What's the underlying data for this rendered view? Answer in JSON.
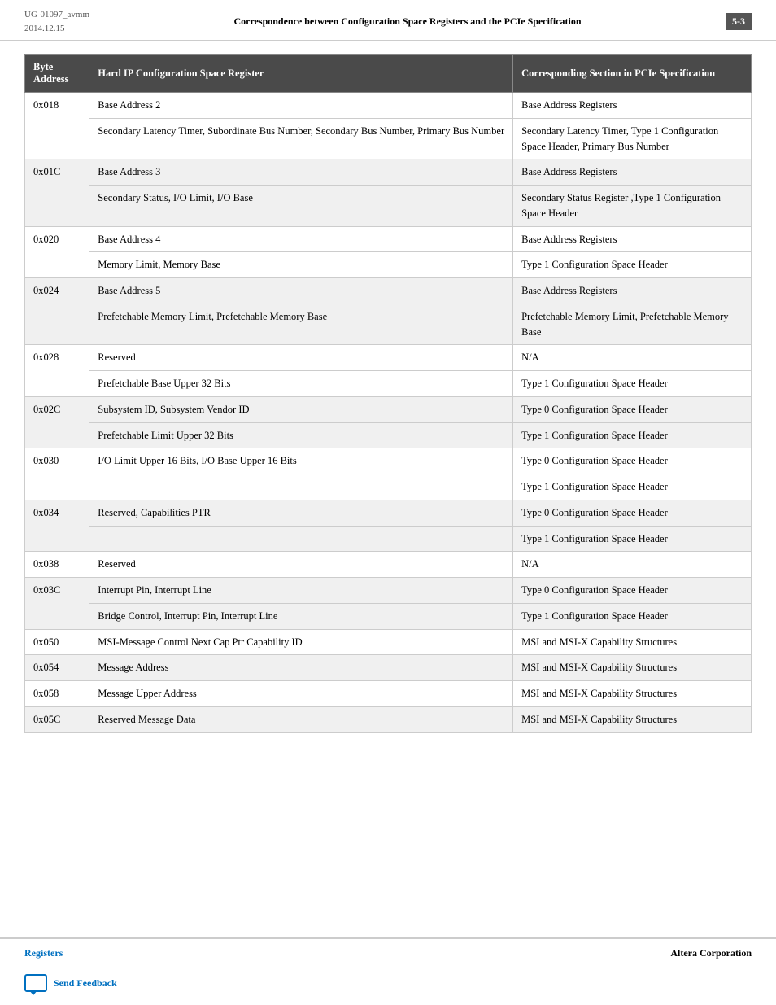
{
  "header": {
    "doc_id": "UG-01097_avmm",
    "date": "2014.12.15",
    "title": "Correspondence between Configuration Space Registers and the PCIe Specification",
    "page": "5-3"
  },
  "table": {
    "columns": [
      "Byte Address",
      "Hard IP Configuration Space Register",
      "Corresponding Section in PCIe Specification"
    ],
    "rows": [
      {
        "address": "0x018",
        "register": "Base Address 2",
        "spec": "Base Address Registers",
        "shaded": false,
        "rowspan": 2
      },
      {
        "address": "",
        "register": "Secondary Latency Timer, Subordinate Bus Number, Secondary Bus Number, Primary Bus Number",
        "spec": "Secondary Latency Timer, Type 1 Configuration Space Header, Primary Bus Number",
        "shaded": false
      },
      {
        "address": "0x01C",
        "register": "Base Address 3",
        "spec": "Base Address Registers",
        "shaded": true,
        "rowspan": 2
      },
      {
        "address": "",
        "register": "Secondary Status, I/O Limit, I/O Base",
        "spec": "Secondary Status Register ,Type 1 Configuration Space Header",
        "shaded": true
      },
      {
        "address": "0x020",
        "register": "Base Address 4",
        "spec": "Base Address Registers",
        "shaded": false,
        "rowspan": 2
      },
      {
        "address": "",
        "register": "Memory Limit, Memory Base",
        "spec": "Type 1 Configuration Space Header",
        "shaded": false
      },
      {
        "address": "0x024",
        "register": "Base Address 5",
        "spec": "Base Address Registers",
        "shaded": true,
        "rowspan": 2
      },
      {
        "address": "",
        "register": "Prefetchable Memory Limit, Prefetchable Memory Base",
        "spec": "Prefetchable Memory Limit, Prefetchable Memory Base",
        "shaded": true
      },
      {
        "address": "0x028",
        "register": "Reserved",
        "spec": "N/A",
        "shaded": false,
        "rowspan": 2
      },
      {
        "address": "",
        "register": "Prefetchable Base Upper 32 Bits",
        "spec": "Type 1 Configuration Space Header",
        "shaded": false
      },
      {
        "address": "0x02C",
        "register": "Subsystem ID, Subsystem Vendor ID",
        "spec": "Type 0 Configuration Space Header",
        "shaded": true,
        "rowspan": 2
      },
      {
        "address": "",
        "register": "Prefetchable Limit Upper 32 Bits",
        "spec": "Type 1 Configuration Space Header",
        "shaded": true
      },
      {
        "address": "0x030",
        "register": "I/O Limit Upper 16 Bits, I/O Base Upper 16 Bits",
        "spec": "Type 0 Configuration Space Header",
        "shaded": false,
        "rowspan": 2
      },
      {
        "address": "",
        "register": "",
        "spec": "Type 1 Configuration Space Header",
        "shaded": false
      },
      {
        "address": "0x034",
        "register": "Reserved, Capabilities PTR",
        "spec": "Type 0 Configuration Space Header",
        "shaded": true,
        "rowspan": 2
      },
      {
        "address": "",
        "register": "",
        "spec": "Type 1 Configuration Space Header",
        "shaded": true
      },
      {
        "address": "0x038",
        "register": "Reserved",
        "spec": "N/A",
        "shaded": false,
        "rowspan": 1
      },
      {
        "address": "0x03C",
        "register": "Interrupt Pin, Interrupt Line",
        "spec": "Type 0 Configuration Space Header",
        "shaded": true,
        "rowspan": 2
      },
      {
        "address": "",
        "register": "Bridge Control, Interrupt Pin, Interrupt Line",
        "spec": "Type 1 Configuration Space Header",
        "shaded": true
      },
      {
        "address": "0x050",
        "register": "MSI-Message Control Next Cap Ptr Capability ID",
        "spec": "MSI and MSI-X Capability Structures",
        "shaded": false,
        "rowspan": 1
      },
      {
        "address": "0x054",
        "register": "Message Address",
        "spec": "MSI and MSI-X Capability Structures",
        "shaded": true,
        "rowspan": 1
      },
      {
        "address": "0x058",
        "register": "Message Upper Address",
        "spec": "MSI and MSI-X Capability Structures",
        "shaded": false,
        "rowspan": 1
      },
      {
        "address": "0x05C",
        "register": "Reserved Message Data",
        "spec": "MSI and MSI-X Capability Structures",
        "shaded": true,
        "rowspan": 1
      }
    ]
  },
  "footer": {
    "left": "Registers",
    "right": "Altera Corporation"
  },
  "feedback": {
    "label": "Send Feedback"
  }
}
